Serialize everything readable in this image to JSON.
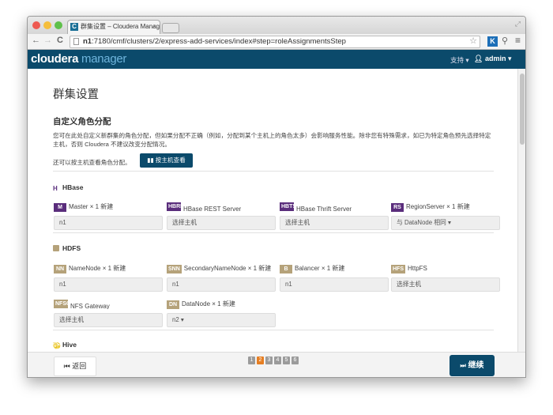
{
  "browser": {
    "tab_title": "群集设置 – Cloudera Manag",
    "url_host": "n1",
    "url_rest": ":7180/cmf/clusters/2/express-add-services/index#step=roleAssignmentsStep",
    "ext_k": "K"
  },
  "nav": {
    "logo_a": "cloudera",
    "logo_b": "manager",
    "support": "支持 ▾",
    "admin": "admin ▾"
  },
  "page": {
    "title": "群集设置",
    "section": "自定义角色分配",
    "description": "您可在此处自定义新群集的角色分配，但如果分配不正确（例如，分配到某个主机上的角色太多）会影响服务性能。除非您有特殊需求，如已为特定角色预先选择特定主机，否则 Cloudera 不建议改变分配情况。",
    "host_view_text": "还可以按主机查看角色分配。",
    "host_view_button": "按主机查看"
  },
  "services": [
    {
      "name": "HBase",
      "icon": "hbase-icon",
      "color": "#5a2d7c",
      "roles": [
        {
          "badge": "M",
          "label": "Master",
          "count": "× 1 新建",
          "value": "n1"
        },
        {
          "badge": "HBRE",
          "label": "HBase REST Server",
          "count": "",
          "value": "选择主机"
        },
        {
          "badge": "HBTS",
          "label": "HBase Thrift Server",
          "count": "",
          "value": "选择主机"
        },
        {
          "badge": "RS",
          "label": "RegionServer",
          "count": "× 1 新建",
          "value": "与 DataNode 相同 ▾"
        }
      ]
    },
    {
      "name": "HDFS",
      "icon": "hdfs-icon",
      "color": "#b5a27a",
      "roles": [
        {
          "badge": "NN",
          "label": "NameNode",
          "count": "× 1 新建",
          "value": "n1"
        },
        {
          "badge": "SNN",
          "label": "SecondaryNameNode",
          "count": "× 1 新建",
          "value": "n1"
        },
        {
          "badge": "B",
          "label": "Balancer",
          "count": "× 1 新建",
          "value": "n1"
        },
        {
          "badge": "HFS",
          "label": "HttpFS",
          "count": "",
          "value": "选择主机"
        },
        {
          "badge": "NFSG",
          "label": "NFS Gateway",
          "count": "",
          "value": "选择主机"
        },
        {
          "badge": "DN",
          "label": "DataNode",
          "count": "× 1 新建",
          "value": "n2 ▾"
        }
      ]
    },
    {
      "name": "Hive",
      "icon": "hive-icon",
      "color": "#e8c21a"
    }
  ],
  "footer": {
    "back": "返回",
    "next": "继续",
    "steps": [
      "1",
      "2",
      "3",
      "4",
      "5",
      "6"
    ],
    "current_step": 2
  }
}
